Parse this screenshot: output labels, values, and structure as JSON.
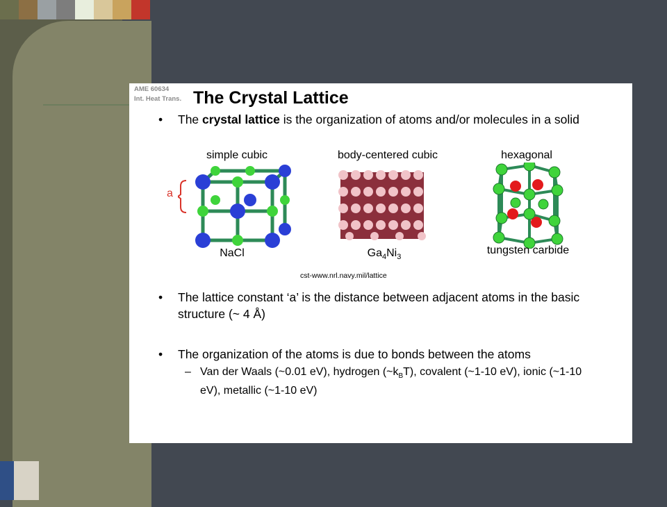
{
  "header": {
    "course_code": "AME 60634",
    "course_name": "Int. Heat Trans.",
    "title": "The Crystal Lattice"
  },
  "bullets": {
    "b1_pre": "The ",
    "b1_bold": "crystal lattice",
    "b1_post": " is the organization of atoms and/or molecules in a solid",
    "b2": "The lattice constant ‘a’ is the distance between adjacent atoms in the basic structure (~ 4 Å)",
    "b3": "The organization of the atoms is due to bonds between the atoms"
  },
  "sub": {
    "part1": "Van der Waals (~0.01 eV), hydrogen (~k",
    "sub_b": "B",
    "part2": "T), covalent (~1-10 eV), ionic (~1-10 eV), metallic (~1-10 eV)"
  },
  "figures": {
    "simple_cubic": "simple cubic",
    "bcc": "body-centered cubic",
    "hexagonal": "hexagonal",
    "nacl": "NaCl",
    "ga": "Ga",
    "ga_sub": "4",
    "ni": "Ni",
    "ni_sub": "3",
    "tungsten": "tungsten carbide",
    "a_label": "a",
    "credit": "cst-www.nrl.navy.mil/lattice"
  },
  "colors": {
    "background": "#424851",
    "panel": "#5c5e4a",
    "panel_light": "#838468",
    "accent_red": "#d9342b"
  }
}
